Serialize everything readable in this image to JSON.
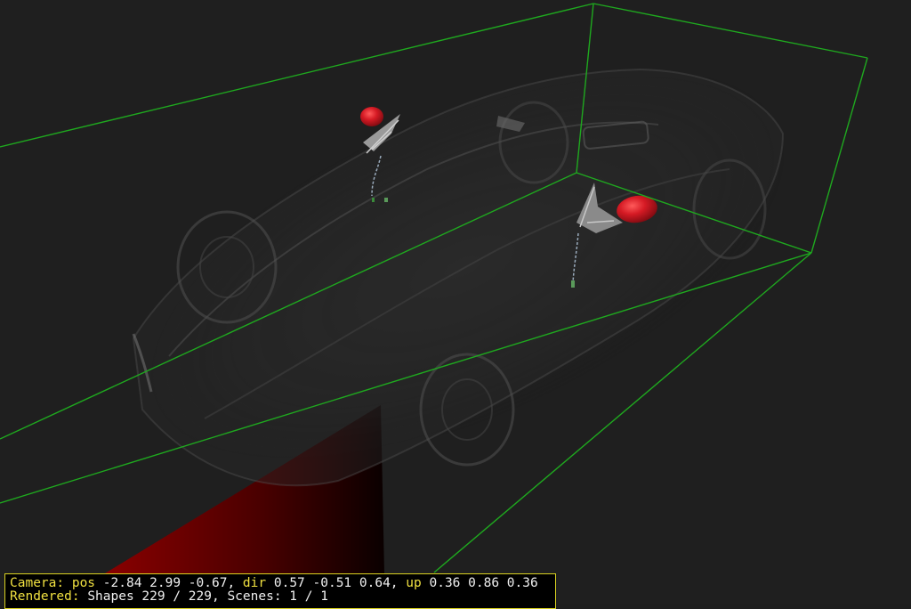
{
  "colors": {
    "background": "#1f1f1f",
    "bounding_box": "#1fa81f",
    "mirror_red": "#d01a24",
    "floor_red": "#7a0000",
    "status_keyword": "#f0e040",
    "status_text": "#f0f0f0",
    "status_border": "#d8d020"
  },
  "status": {
    "camera_label": "Camera:",
    "pos_label": "pos",
    "pos_value": "-2.84 2.99 -0.67,",
    "dir_label": "dir",
    "dir_value": "0.57 -0.51 0.64,",
    "up_label": "up",
    "up_value": "0.36 0.86 0.36",
    "rendered_label": "Rendered:",
    "rendered_value": "Shapes 229 / 229, Scenes: 1 / 1"
  }
}
